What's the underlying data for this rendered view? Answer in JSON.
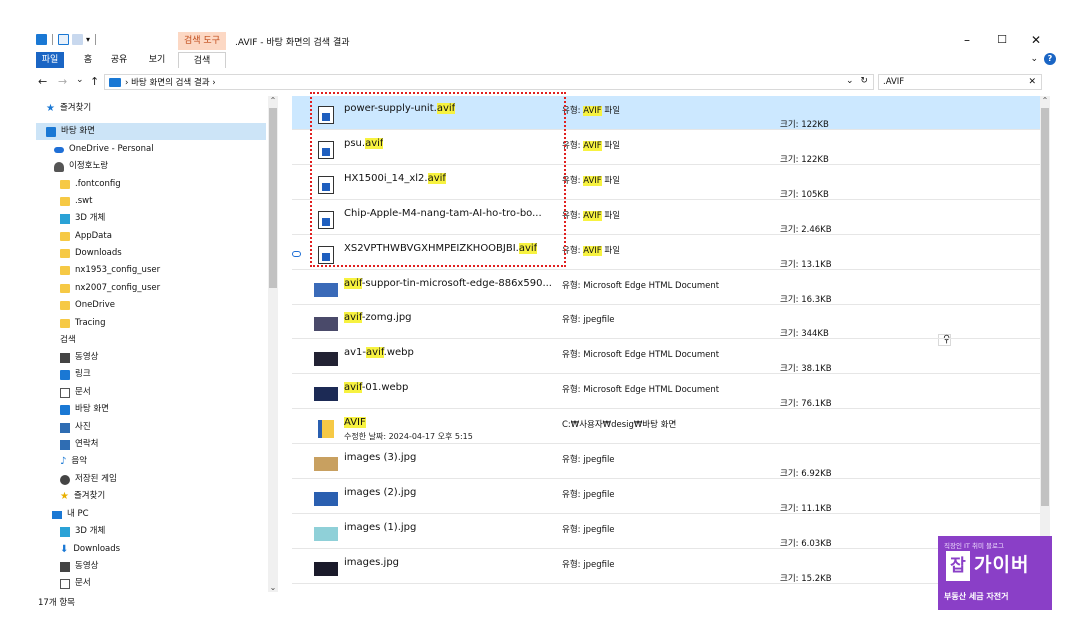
{
  "window": {
    "context_tab": "검색 도구",
    "title": ".AVIF - 바탕 화면의 검색 결과",
    "minimize": "–",
    "maximize": "☐",
    "close": "✕"
  },
  "ribbon": {
    "tabs": [
      "파일",
      "홈",
      "공유",
      "보기",
      "검색"
    ],
    "chevron": "⌄",
    "help": "?"
  },
  "address": {
    "back": "←",
    "forward": "→",
    "recent": "⌄",
    "up": "↑",
    "path": "› 바탕 화면의 검색 결과 ›",
    "dropdown": "⌄",
    "refresh": "↻",
    "search_value": ".AVIF",
    "search_clear": "✕"
  },
  "nav": {
    "items": [
      {
        "label": "즐겨찾기",
        "icon": "star-icon"
      },
      {
        "label": "바탕 화면",
        "icon": "desktop-icon"
      },
      {
        "label": "OneDrive - Personal",
        "icon": "cloud-icon"
      },
      {
        "label": "이정호노랑",
        "icon": "user-icon"
      },
      {
        "label": ".fontconfig",
        "icon": "folder-icon"
      },
      {
        "label": ".swt",
        "icon": "folder-icon"
      },
      {
        "label": "3D 개체",
        "icon": "cube-icon"
      },
      {
        "label": "AppData",
        "icon": "folder-icon"
      },
      {
        "label": "Downloads",
        "icon": "folder-icon"
      },
      {
        "label": "nx1953_config_user",
        "icon": "folder-icon"
      },
      {
        "label": "nx2007_config_user",
        "icon": "folder-icon"
      },
      {
        "label": "OneDrive",
        "icon": "folder-icon"
      },
      {
        "label": "Tracing",
        "icon": "folder-icon"
      },
      {
        "label": "검색",
        "icon": "search-icon"
      },
      {
        "label": "동영상",
        "icon": "video-icon"
      },
      {
        "label": "링크",
        "icon": "link-icon"
      },
      {
        "label": "문서",
        "icon": "document-icon"
      },
      {
        "label": "바탕 화면",
        "icon": "desktop-icon"
      },
      {
        "label": "사진",
        "icon": "picture-icon"
      },
      {
        "label": "연락처",
        "icon": "contact-icon"
      },
      {
        "label": "음악",
        "icon": "music-icon"
      },
      {
        "label": "저장된 게임",
        "icon": "game-icon"
      },
      {
        "label": "즐겨찾기",
        "icon": "favorite-star-icon"
      },
      {
        "label": "내 PC",
        "icon": "pc-icon"
      },
      {
        "label": "3D 개체",
        "icon": "cube-icon"
      },
      {
        "label": "Downloads",
        "icon": "download-icon"
      },
      {
        "label": "동영상",
        "icon": "video-icon"
      },
      {
        "label": "문서",
        "icon": "document-icon"
      }
    ],
    "scroll_up": "⌃",
    "scroll_down": "⌄"
  },
  "status": {
    "count": "17개 항목"
  },
  "files": [
    {
      "name_pre": "power-supply-unit.",
      "name_hl": "avif",
      "name_post": "",
      "type_pre": "유형: ",
      "type_hl": "AVIF",
      "type_post": " 파일",
      "size": "크기: 122KB",
      "icon": "avif-file-icon"
    },
    {
      "name_pre": "psu.",
      "name_hl": "avif",
      "name_post": "",
      "type_pre": "유형: ",
      "type_hl": "AVIF",
      "type_post": " 파일",
      "size": "크기: 122KB",
      "icon": "avif-file-icon"
    },
    {
      "name_pre": "HX1500i_14_xl2.",
      "name_hl": "avif",
      "name_post": "",
      "type_pre": "유형: ",
      "type_hl": "AVIF",
      "type_post": " 파일",
      "size": "크기: 105KB",
      "icon": "avif-file-icon"
    },
    {
      "name_pre": "Chip-Apple-M4-nang-tam-AI-ho-tro-bo...",
      "name_hl": "",
      "name_post": "",
      "type_pre": "유형: ",
      "type_hl": "AVIF",
      "type_post": " 파일",
      "size": "크기: 2.46KB",
      "icon": "avif-file-icon"
    },
    {
      "name_pre": "XS2VPTHWBVGXHMPEIZKHOOBJBI.",
      "name_hl": "avif",
      "name_post": "",
      "type_pre": "유형: ",
      "type_hl": "AVIF",
      "type_post": " 파일",
      "size": "크기: 13.1KB",
      "icon": "avif-file-icon"
    },
    {
      "name_pre": "",
      "name_hl": "avif",
      "name_post": "-suppor-tin-microsoft-edge-886x590....",
      "type_pre": "유형: Microsoft Edge HTML Document",
      "type_hl": "",
      "type_post": "",
      "size": "크기: 16.3KB",
      "icon": "image-thumbnail-icon"
    },
    {
      "name_pre": "",
      "name_hl": "avif",
      "name_post": "-zomg.jpg",
      "type_pre": "유형: jpegfile",
      "type_hl": "",
      "type_post": "",
      "size": "크기: 344KB",
      "icon": "image-thumbnail-icon"
    },
    {
      "name_pre": "av1-",
      "name_hl": "avif",
      "name_post": ".webp",
      "type_pre": "유형: Microsoft Edge HTML Document",
      "type_hl": "",
      "type_post": "",
      "size": "크기: 38.1KB",
      "icon": "image-thumbnail-icon"
    },
    {
      "name_pre": "",
      "name_hl": "avif",
      "name_post": "-01.webp",
      "type_pre": "유형: Microsoft Edge HTML Document",
      "type_hl": "",
      "type_post": "",
      "size": "크기: 76.1KB",
      "icon": "image-thumbnail-icon"
    },
    {
      "name_pre": "",
      "name_hl": "AVIF",
      "name_post": "",
      "sub": "수정한 날짜: 2024-04-17 오후 5:15",
      "type_pre": "C:₩사용자₩desig₩바탕 화면",
      "type_hl": "",
      "type_post": "",
      "size": "",
      "icon": "folder-icon"
    },
    {
      "name_pre": "images (3).jpg",
      "name_hl": "",
      "name_post": "",
      "type_pre": "유형: jpegfile",
      "type_hl": "",
      "type_post": "",
      "size": "크기: 6.92KB",
      "icon": "image-thumbnail-icon"
    },
    {
      "name_pre": "images (2).jpg",
      "name_hl": "",
      "name_post": "",
      "type_pre": "유형: jpegfile",
      "type_hl": "",
      "type_post": "",
      "size": "크기: 11.1KB",
      "icon": "image-thumbnail-icon"
    },
    {
      "name_pre": "images (1).jpg",
      "name_hl": "",
      "name_post": "",
      "type_pre": "유형: jpegfile",
      "type_hl": "",
      "type_post": "",
      "size": "크기: 6.03KB",
      "icon": "image-thumbnail-icon"
    },
    {
      "name_pre": "images.jpg",
      "name_hl": "",
      "name_post": "",
      "type_pre": "유형: jpegfile",
      "type_hl": "",
      "type_post": "",
      "size": "크기: 15.2KB",
      "icon": "image-thumbnail-icon"
    }
  ],
  "watermark": {
    "top": "직장인 IT 취미 블로그",
    "box": "잡",
    "main": "가이버",
    "bottom": "부동산 세금 자전거"
  }
}
